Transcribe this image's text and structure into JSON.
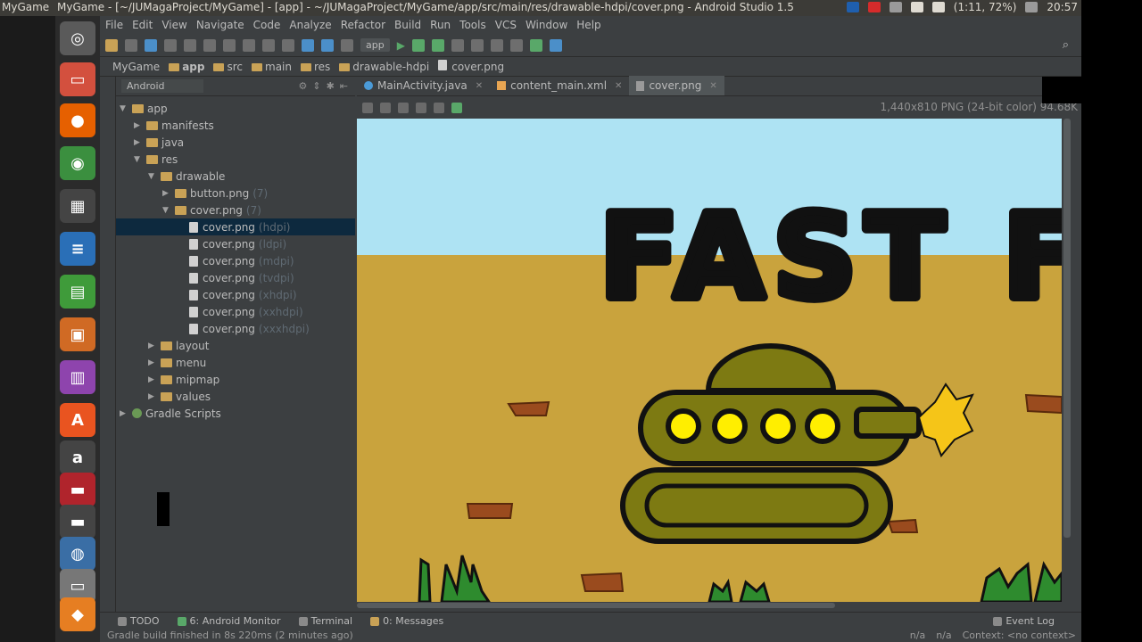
{
  "topbar": {
    "app_name": "MyGame",
    "window_title": "MyGame - [~/JUMagaProject/MyGame] - [app] - ~/JUMagaProject/MyGame/app/src/main/res/drawable-hdpi/cover.png - Android Studio 1.5",
    "battery": "(1:11, 72%)",
    "clock": "20:57"
  },
  "menu": [
    "File",
    "Edit",
    "View",
    "Navigate",
    "Code",
    "Analyze",
    "Refactor",
    "Build",
    "Run",
    "Tools",
    "VCS",
    "Window",
    "Help"
  ],
  "toolbar": {
    "run_config": "app"
  },
  "breadcrumb": [
    "MyGame",
    "app",
    "src",
    "main",
    "res",
    "drawable-hdpi",
    "cover.png"
  ],
  "project_panel": {
    "view_mode": "Android",
    "tree": [
      {
        "label": "app",
        "hint": ""
      },
      {
        "label": "manifests",
        "hint": ""
      },
      {
        "label": "java",
        "hint": ""
      },
      {
        "label": "res",
        "hint": ""
      },
      {
        "label": "drawable",
        "hint": ""
      },
      {
        "label": "button.png",
        "hint": "(7)"
      },
      {
        "label": "cover.png",
        "hint": "(7)"
      },
      {
        "label": "cover.png",
        "hint": "(hdpi)"
      },
      {
        "label": "cover.png",
        "hint": "(ldpi)"
      },
      {
        "label": "cover.png",
        "hint": "(mdpi)"
      },
      {
        "label": "cover.png",
        "hint": "(tvdpi)"
      },
      {
        "label": "cover.png",
        "hint": "(xhdpi)"
      },
      {
        "label": "cover.png",
        "hint": "(xxhdpi)"
      },
      {
        "label": "cover.png",
        "hint": "(xxxhdpi)"
      },
      {
        "label": "layout",
        "hint": ""
      },
      {
        "label": "menu",
        "hint": ""
      },
      {
        "label": "mipmap",
        "hint": ""
      },
      {
        "label": "values",
        "hint": ""
      },
      {
        "label": "Gradle Scripts",
        "hint": ""
      }
    ]
  },
  "tabs": [
    {
      "label": "MainActivity.java"
    },
    {
      "label": "content_main.xml"
    },
    {
      "label": "cover.png"
    }
  ],
  "image_info": "1,440x810 PNG (24-bit color) 94.68K",
  "cover_title": "FAST FI",
  "bottom_tools": [
    "TODO",
    "6: Android Monitor",
    "Terminal",
    "0: Messages",
    "Event Log"
  ],
  "status": {
    "message": "Gradle build finished in 8s 220ms (2 minutes ago)",
    "pos1": "n/a",
    "pos2": "n/a",
    "context": "Context: <no context>"
  },
  "colors": {
    "sky": "#aee3f3",
    "sand": "#c9a33d",
    "tank": "#7d7a12",
    "tank_lights": "#ffee00",
    "ide_bg": "#3c3f41",
    "selection": "#0d293e"
  }
}
